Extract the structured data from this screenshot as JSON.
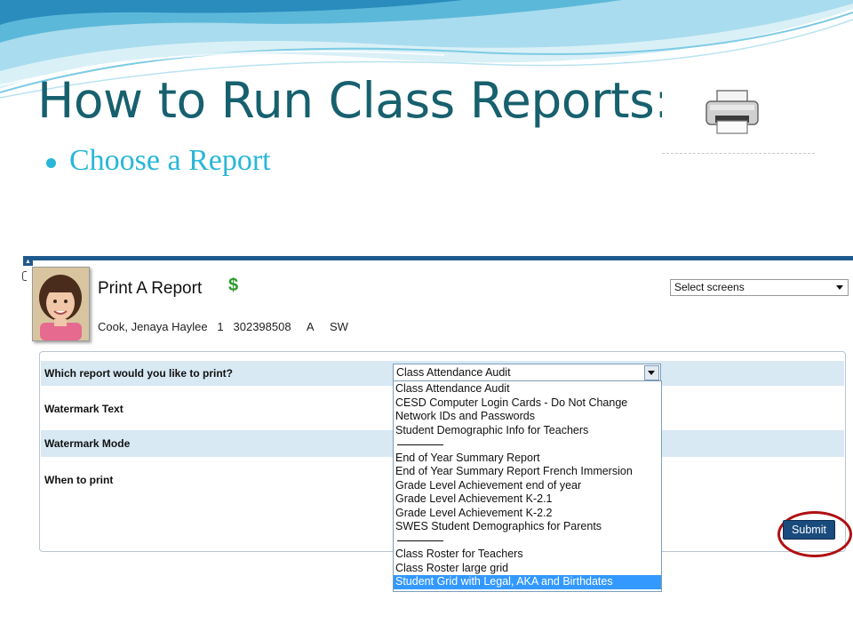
{
  "slide": {
    "title": "How to Run Class Reports:",
    "bullet": "Choose a Report"
  },
  "colors": {
    "title": "#17606e",
    "bullet": "#29b6d8",
    "header_bar": "#1f5a8f",
    "row_shade": "#d8e9f4",
    "selected_option": "#3399ff",
    "submit_button": "#1a4b7d",
    "annotation_ring": "#b00f12"
  },
  "icons": {
    "printer": "printer-icon",
    "currency": "dollar-icon"
  },
  "screen": {
    "page_title": "Print A Report",
    "dollar": "$",
    "student": {
      "name": "Cook, Jenaya Haylee",
      "grade": "1",
      "id": "302398508",
      "gender": "A",
      "school": "SW"
    },
    "select_screens": "Select screens",
    "form": {
      "rows": [
        {
          "label": "Which report would you like to print?"
        },
        {
          "label": "Watermark Text"
        },
        {
          "label": "Watermark Mode"
        },
        {
          "label": "When to print"
        }
      ],
      "report_select_value": "Class Attendance Audit",
      "options": [
        "Class Attendance Audit",
        "CESD Computer Login Cards - Do Not Change",
        "Network IDs and Passwords",
        "Student Demographic Info for Teachers",
        "---------------",
        "End of Year Summary Report",
        "End of Year Summary Report French Immersion",
        "Grade Level Achievement end of year",
        "Grade Level Achievement K-2.1",
        "Grade Level Achievement K-2.2",
        "SWES Student Demographics for Parents",
        "---------------",
        "Class Roster for Teachers",
        "Class Roster large grid",
        "Student Grid with Legal, AKA and Birthdates"
      ],
      "selected_option": "Student Grid with Legal, AKA and Birthdates",
      "submit": "Submit"
    }
  }
}
